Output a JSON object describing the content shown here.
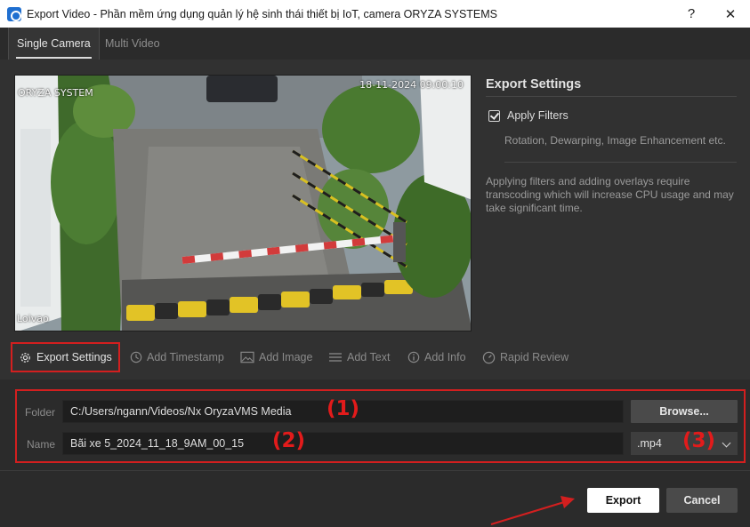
{
  "window": {
    "title": "Export Video - Phần mềm ứng dụng quản lý hệ sinh thái thiết bị IoT, camera ORYZA SYSTEMS",
    "help_glyph": "?",
    "close_glyph": "✕"
  },
  "tabs": [
    {
      "label": "Single Camera",
      "active": true
    },
    {
      "label": "Multi Video",
      "active": false
    }
  ],
  "preview": {
    "camera_name": "ORYZA SYSTEM",
    "timestamp": "18-11-2024 09:00:10",
    "corner_label": "Loivao"
  },
  "settings": {
    "heading": "Export Settings",
    "apply_filters_label": "Apply Filters",
    "apply_filters_checked": true,
    "filters_description": "Rotation, Dewarping, Image Enhancement etc.",
    "note": "Applying filters and adding overlays require transcoding which will increase CPU usage and may take significant time."
  },
  "toolbar": [
    {
      "label": "Export Settings",
      "icon": "gear-icon",
      "active": true
    },
    {
      "label": "Add Timestamp",
      "icon": "clock-icon",
      "active": false
    },
    {
      "label": "Add Image",
      "icon": "image-icon",
      "active": false
    },
    {
      "label": "Add Text",
      "icon": "text-lines-icon",
      "active": false
    },
    {
      "label": "Add Info",
      "icon": "info-icon",
      "active": false
    },
    {
      "label": "Rapid Review",
      "icon": "speed-gauge-icon",
      "active": false
    }
  ],
  "form": {
    "folder_label": "Folder",
    "folder_value": "C:/Users/ngann/Videos/Nx OryzaVMS Media",
    "browse_label": "Browse...",
    "name_label": "Name",
    "name_value": "Bãi xe 5_2024_11_18_9AM_00_15",
    "format_value": ".mp4"
  },
  "annotations": {
    "marker_1": "(1)",
    "marker_2": "(2)",
    "marker_3": "(3)"
  },
  "footer": {
    "export_label": "Export",
    "cancel_label": "Cancel"
  },
  "colors": {
    "annotation_red": "#d31f1f",
    "window_bg": "#2b2b2b",
    "panel_bg": "#313131"
  }
}
